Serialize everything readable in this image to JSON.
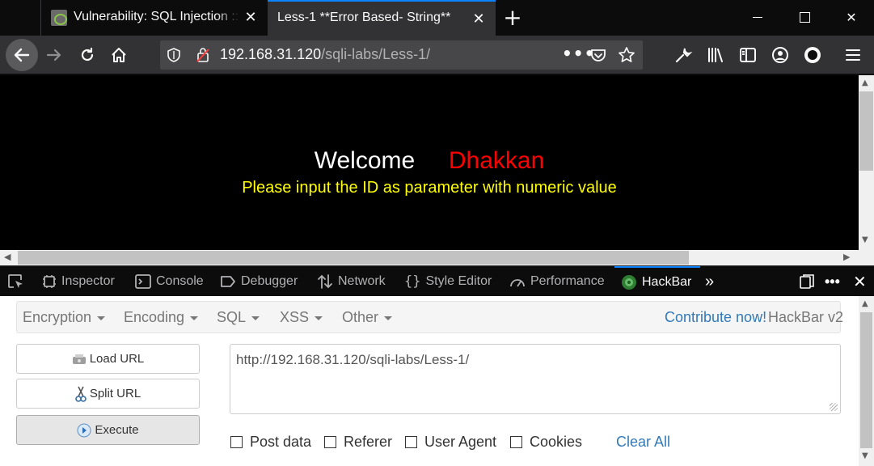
{
  "tabs": [
    {
      "title": "Vulnerability: SQL Injection :: Damn",
      "active": false
    },
    {
      "title": "Less-1 **Error Based- String**",
      "active": true
    }
  ],
  "window_controls": {
    "minimize": "minimize",
    "maximize": "maximize",
    "close": "close"
  },
  "urlbar": {
    "host": "192.168.31.120",
    "path": "/sqli-labs/Less-1/",
    "overflow": "•••"
  },
  "page": {
    "welcome": "Welcome",
    "name": "Dhakkan",
    "prompt": "Please input the ID as parameter with numeric value",
    "colors": {
      "background": "#000000",
      "welcome": "#ffffff",
      "name": "#ff0000",
      "prompt": "#ffff00"
    }
  },
  "devtools": {
    "tabs": [
      "Inspector",
      "Console",
      "Debugger",
      "Network",
      "Style Editor",
      "Performance",
      "HackBar"
    ],
    "active_tab": "HackBar",
    "accent": "#0a84ff"
  },
  "hackbar": {
    "menu": [
      "Encryption",
      "Encoding",
      "SQL",
      "XSS",
      "Other"
    ],
    "contribute": "Contribute now!",
    "version": "HackBar v2",
    "buttons": {
      "load": "Load URL",
      "split": "Split URL",
      "execute": "Execute"
    },
    "url_value": "http://192.168.31.120/sqli-labs/Less-1/",
    "checkboxes": [
      "Post data",
      "Referer",
      "User Agent",
      "Cookies"
    ],
    "clear_all": "Clear All",
    "link_color": "#337ab7"
  }
}
